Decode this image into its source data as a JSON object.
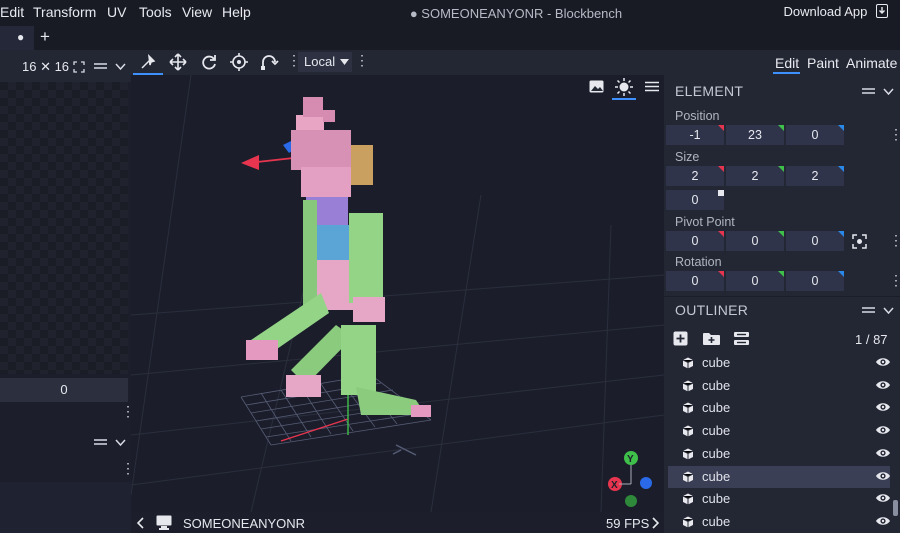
{
  "menu": [
    "Edit",
    "Transform",
    "UV",
    "Tools",
    "View",
    "Help"
  ],
  "window_title": "● SOMEONEANYONR - Blockbench",
  "download_label": "Download App",
  "tabs": {
    "dot": "●",
    "add": "+"
  },
  "left": {
    "resolution": "16 ✕ 16",
    "value": "0"
  },
  "viewport": {
    "local_label": "Local",
    "status_name": "SOMEONEANYONR",
    "fps": "59 FPS"
  },
  "modes": [
    "Edit",
    "Paint",
    "Animate"
  ],
  "element": {
    "title": "ELEMENT",
    "position_label": "Position",
    "position": [
      "-1",
      "23",
      "0"
    ],
    "size_label": "Size",
    "size": [
      "2",
      "2",
      "2"
    ],
    "inflate": "0",
    "pivot_label": "Pivot Point",
    "pivot": [
      "0",
      "0",
      "0"
    ],
    "rotation_label": "Rotation",
    "rotation": [
      "0",
      "0",
      "0"
    ]
  },
  "outliner": {
    "title": "OUTLINER",
    "count": "1 / 87",
    "items": [
      "cube",
      "cube",
      "cube",
      "cube",
      "cube",
      "cube",
      "cube",
      "cube"
    ],
    "selected_index": 5
  },
  "gizmo": {
    "y": "Y",
    "x": "X"
  },
  "colors": {
    "accent": "#3e90ff",
    "red": "#e8354f",
    "green": "#3fc04a",
    "blue": "#2a88e8"
  }
}
